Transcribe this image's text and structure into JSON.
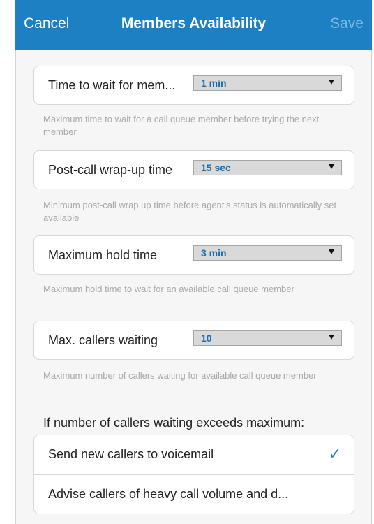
{
  "header": {
    "cancel_label": "Cancel",
    "title": "Members Availability",
    "save_label": "Save"
  },
  "settings": [
    {
      "label": "Time to wait for mem...",
      "value": "1 min",
      "description": "Maximum time to wait for a call queue member before trying the next member"
    },
    {
      "label": "Post-call wrap-up time",
      "value": "15 sec",
      "description": "Minimum post-call wrap up time before agent's status is automatically set available"
    },
    {
      "label": "Maximum hold time",
      "value": "3 min",
      "description": "Maximum hold time to wait for an available call queue member"
    },
    {
      "label": "Max. callers waiting",
      "value": "10",
      "description": "Maximum number of callers waiting for available call queue member"
    }
  ],
  "overflow": {
    "heading": "If number of callers waiting exceeds maximum:",
    "options": [
      {
        "label": "Send new callers to voicemail",
        "selected": true
      },
      {
        "label": "Advise callers of heavy call volume and d...",
        "selected": false
      }
    ],
    "check_glyph": "✓"
  },
  "colors": {
    "accent": "#1d80c2",
    "select_value": "#1a6fb0",
    "description_text": "#a9a9a9",
    "background": "#f6f6f6"
  },
  "icons": {
    "dropdown": "triangle-down-icon",
    "selected": "checkmark-icon"
  }
}
